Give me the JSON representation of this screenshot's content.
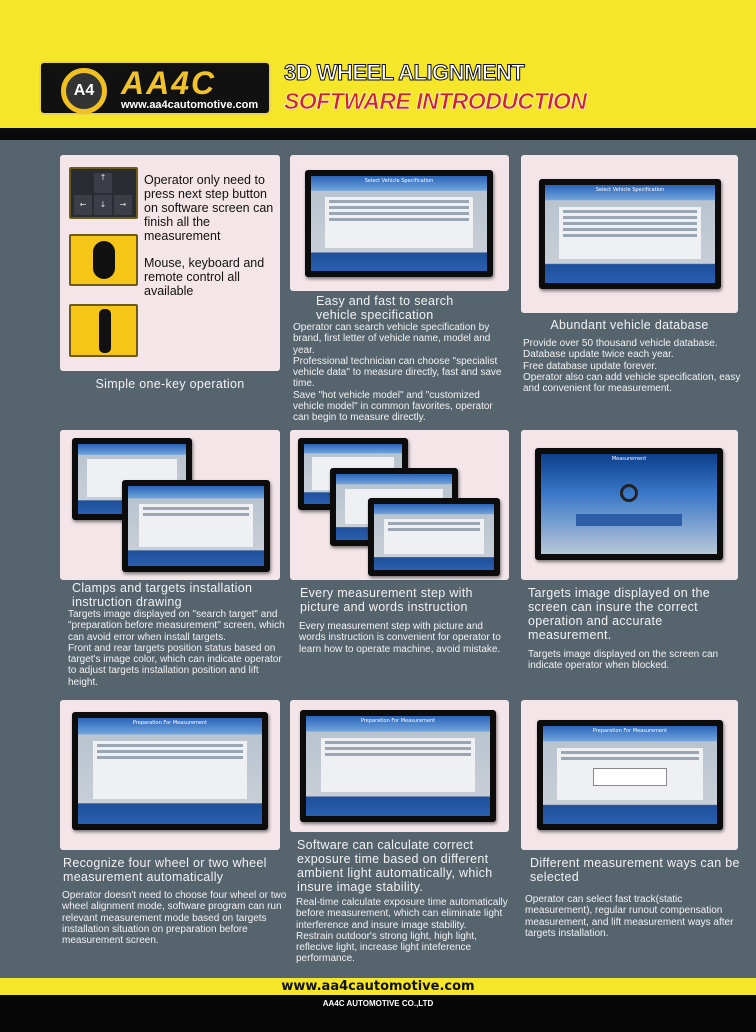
{
  "header": {
    "logo_text": "AA4C",
    "logo_badge": "A4",
    "logo_url": "www.aa4cautomotive.com",
    "title_line1": "3D WHEEL ALIGNMENT",
    "title_line2": "SOFTWARE INTRODUCTION",
    "accent_color": "#d0242c",
    "brand_yellow": "#f5e62a"
  },
  "sections": [
    {
      "heading": "Simple one-key operation",
      "side_text_1": "Operator only need to press next step button on software screen can finish all the measurement",
      "side_text_2": "Mouse, keyboard and remote control all available",
      "images": [
        "keyboard-arrows",
        "mouse",
        "remote-control"
      ]
    },
    {
      "heading": "Easy and fast to search vehicle specification",
      "body": "Operator can search vehicle specification by brand, first letter of vehicle name, model and year.\nProfessional technician can choose \"specialist vehicle data\" to measure directly, fast and save time.\nSave \"hot vehicle model\" and \"customized vehicle model\" in common favorites, operator can begin to measure directly.",
      "screen_title": "Select Vehicle Specification"
    },
    {
      "heading": "Abundant vehicle database",
      "body": "Provide over 50 thousand vehicle database.\nDatabase update twice each year.\nFree database update forever.\nOperator also can add vehicle specification, easy and convenient for measurement.",
      "screen_title": "Select Vehicle Specification"
    },
    {
      "heading": "Clamps and targets installation instruction drawing",
      "body": "Targets image displayed on \"search target\" and \"preparation before measurement\" screen, which can avoid error when install targets.\nFront and rear targets position status based on target's image color, which can indicate operator to adjust targets installation position and lift height."
    },
    {
      "heading": "Every measurement step with picture and words instruction",
      "body": "Every measurement step with picture and words instruction is convenient for operator to learn how to operate machine, avoid mistake."
    },
    {
      "heading": "Targets image displayed on the screen can insure the correct operation and accurate measurement.",
      "body": "Targets image displayed on the screen can indicate operator when blocked.",
      "screen_title": "Measurement"
    },
    {
      "heading": "Recognize four wheel or two wheel measurement automatically",
      "body": "Operator doesn't need to choose four wheel or two wheel alignment mode, software program can run relevant measurement mode based on targets installation situation on preparation before measurement screen.",
      "screen_title": "Preparation For Measurement"
    },
    {
      "heading": "Software can calculate correct exposure time based on different ambient light automatically, which insure image stability.",
      "body": "Real-time calculate exposure time automatically before measurement, which can eliminate light interference and insure image stability.\nRestrain outdoor's strong light, high light, reflecive light, increase light inteference performance.",
      "screen_title": "Preparation For Measurement"
    },
    {
      "heading": "Different measurement ways can be selected",
      "body": "Operator can select fast track(static measurement), regular runout compensation measurement, and lift measurement ways after targets installation.",
      "screen_title": "Preparation For Measurement"
    }
  ],
  "footer": {
    "url": "www.aa4cautomotive.com",
    "company": "AA4C AUTOMOTIVE CO.,LTD"
  }
}
